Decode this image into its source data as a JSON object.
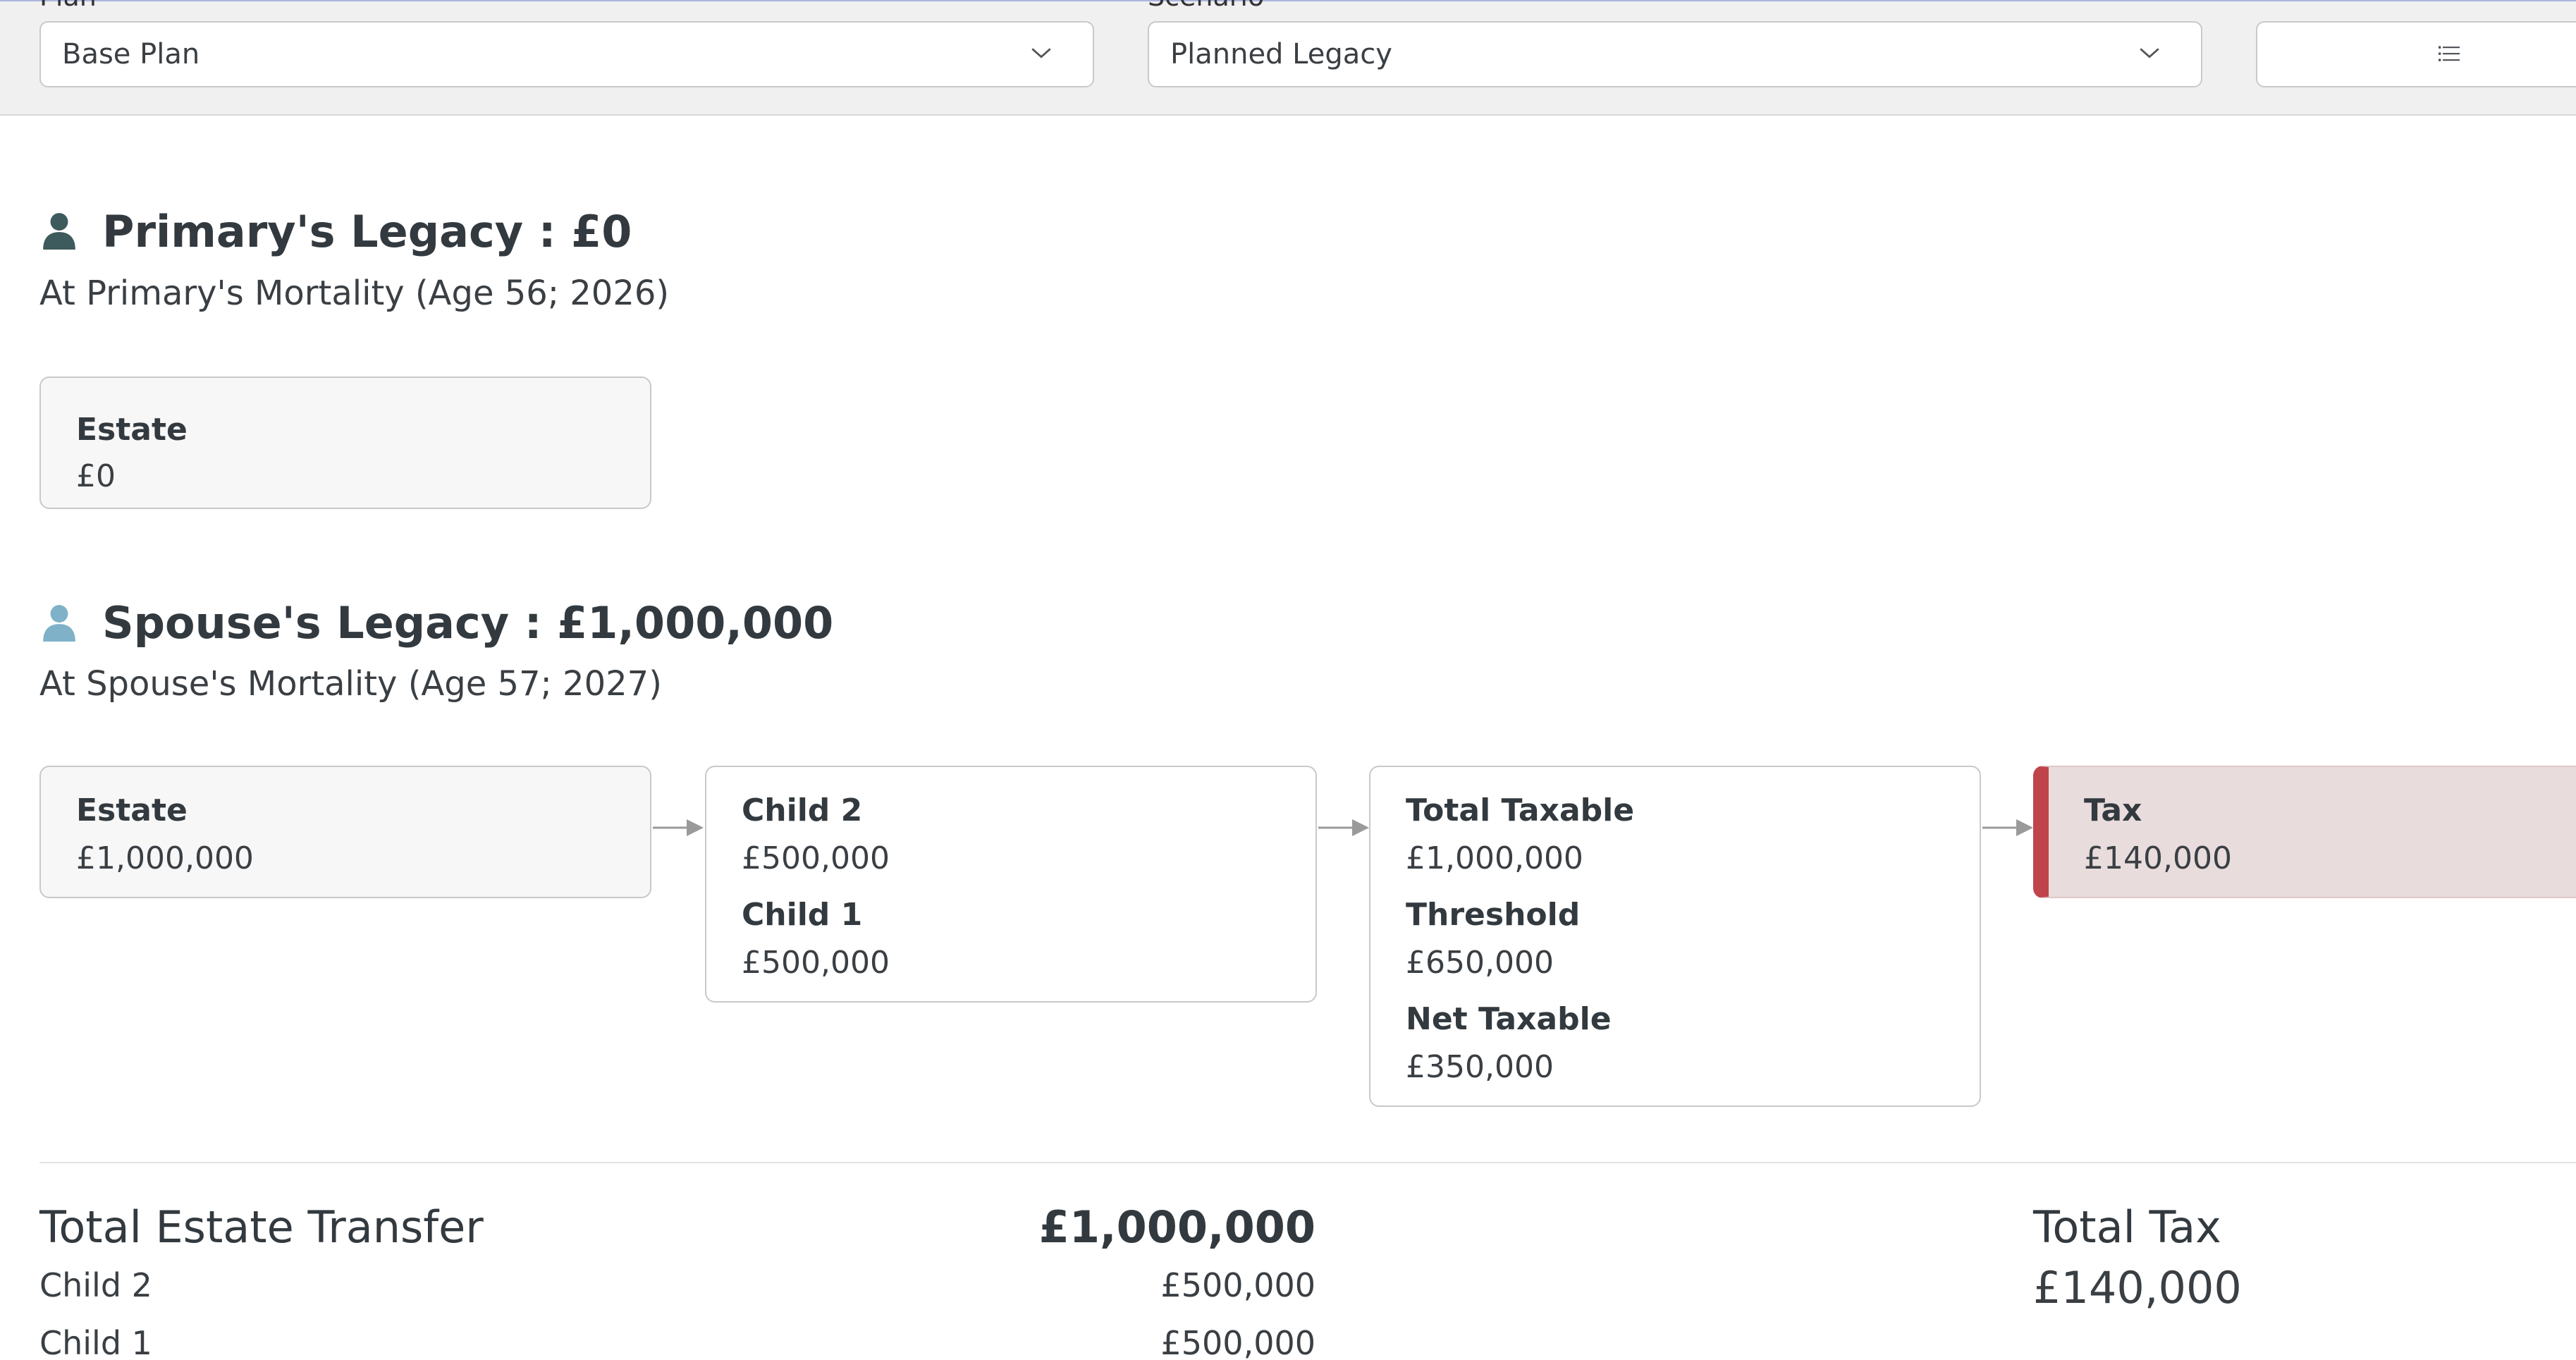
{
  "filters": {
    "plan": {
      "label": "Plan",
      "value": "Base Plan",
      "icon": "chevron-down-icon"
    },
    "scenario": {
      "label": "Scenario",
      "value": "Planned Legacy",
      "icon": "chevron-down-icon"
    },
    "view_button": {
      "icon": "list-icon"
    }
  },
  "primary": {
    "icon": "person-icon",
    "icon_color": "#3d5a5c",
    "title": "Primary's Legacy : £0",
    "subtitle": "At Primary's Mortality (Age 56; 2026)",
    "estate": {
      "label": "Estate",
      "value": "£0"
    }
  },
  "spouse": {
    "icon": "person-icon",
    "icon_color": "#7fb2c9",
    "title": "Spouse's Legacy : £1,000,000",
    "subtitle": "At Spouse's Mortality (Age 57; 2027)",
    "estate": {
      "label": "Estate",
      "value": "£1,000,000"
    },
    "beneficiaries": [
      {
        "label": "Child 2",
        "value": "£500,000"
      },
      {
        "label": "Child 1",
        "value": "£500,000"
      }
    ],
    "taxable": [
      {
        "label": "Total Taxable",
        "value": "£1,000,000"
      },
      {
        "label": "Threshold",
        "value": "£650,000"
      },
      {
        "label": "Net Taxable",
        "value": "£350,000"
      }
    ],
    "tax": {
      "label": "Tax",
      "value": "£140,000",
      "accent": "#c0444c"
    }
  },
  "summary": {
    "title": "Total Estate Transfer",
    "total": "£1,000,000",
    "rows": [
      {
        "label": "Child 2",
        "value": "£500,000"
      },
      {
        "label": "Child 1",
        "value": "£500,000"
      }
    ],
    "tax_title": "Total Tax",
    "tax_value": "£140,000"
  }
}
